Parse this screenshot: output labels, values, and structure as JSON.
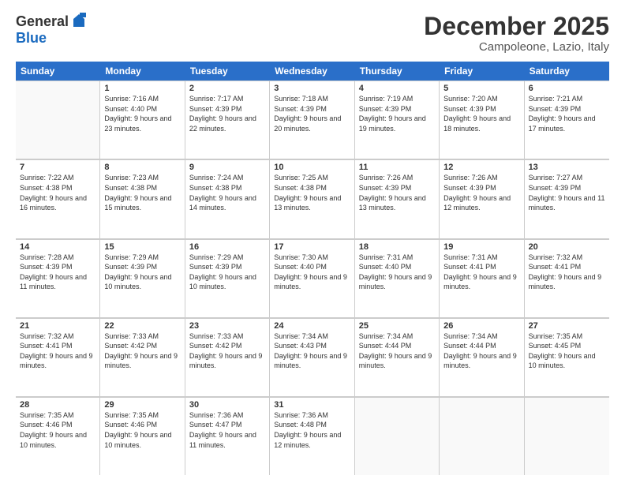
{
  "logo": {
    "general": "General",
    "blue": "Blue"
  },
  "title": "December 2025",
  "location": "Campoleone, Lazio, Italy",
  "header_days": [
    "Sunday",
    "Monday",
    "Tuesday",
    "Wednesday",
    "Thursday",
    "Friday",
    "Saturday"
  ],
  "rows": [
    [
      {
        "day": "",
        "sunrise": "",
        "sunset": "",
        "daylight": "",
        "empty": true
      },
      {
        "day": "1",
        "sunrise": "Sunrise: 7:16 AM",
        "sunset": "Sunset: 4:40 PM",
        "daylight": "Daylight: 9 hours and 23 minutes."
      },
      {
        "day": "2",
        "sunrise": "Sunrise: 7:17 AM",
        "sunset": "Sunset: 4:39 PM",
        "daylight": "Daylight: 9 hours and 22 minutes."
      },
      {
        "day": "3",
        "sunrise": "Sunrise: 7:18 AM",
        "sunset": "Sunset: 4:39 PM",
        "daylight": "Daylight: 9 hours and 20 minutes."
      },
      {
        "day": "4",
        "sunrise": "Sunrise: 7:19 AM",
        "sunset": "Sunset: 4:39 PM",
        "daylight": "Daylight: 9 hours and 19 minutes."
      },
      {
        "day": "5",
        "sunrise": "Sunrise: 7:20 AM",
        "sunset": "Sunset: 4:39 PM",
        "daylight": "Daylight: 9 hours and 18 minutes."
      },
      {
        "day": "6",
        "sunrise": "Sunrise: 7:21 AM",
        "sunset": "Sunset: 4:39 PM",
        "daylight": "Daylight: 9 hours and 17 minutes."
      }
    ],
    [
      {
        "day": "7",
        "sunrise": "Sunrise: 7:22 AM",
        "sunset": "Sunset: 4:38 PM",
        "daylight": "Daylight: 9 hours and 16 minutes."
      },
      {
        "day": "8",
        "sunrise": "Sunrise: 7:23 AM",
        "sunset": "Sunset: 4:38 PM",
        "daylight": "Daylight: 9 hours and 15 minutes."
      },
      {
        "day": "9",
        "sunrise": "Sunrise: 7:24 AM",
        "sunset": "Sunset: 4:38 PM",
        "daylight": "Daylight: 9 hours and 14 minutes."
      },
      {
        "day": "10",
        "sunrise": "Sunrise: 7:25 AM",
        "sunset": "Sunset: 4:38 PM",
        "daylight": "Daylight: 9 hours and 13 minutes."
      },
      {
        "day": "11",
        "sunrise": "Sunrise: 7:26 AM",
        "sunset": "Sunset: 4:39 PM",
        "daylight": "Daylight: 9 hours and 13 minutes."
      },
      {
        "day": "12",
        "sunrise": "Sunrise: 7:26 AM",
        "sunset": "Sunset: 4:39 PM",
        "daylight": "Daylight: 9 hours and 12 minutes."
      },
      {
        "day": "13",
        "sunrise": "Sunrise: 7:27 AM",
        "sunset": "Sunset: 4:39 PM",
        "daylight": "Daylight: 9 hours and 11 minutes."
      }
    ],
    [
      {
        "day": "14",
        "sunrise": "Sunrise: 7:28 AM",
        "sunset": "Sunset: 4:39 PM",
        "daylight": "Daylight: 9 hours and 11 minutes."
      },
      {
        "day": "15",
        "sunrise": "Sunrise: 7:29 AM",
        "sunset": "Sunset: 4:39 PM",
        "daylight": "Daylight: 9 hours and 10 minutes."
      },
      {
        "day": "16",
        "sunrise": "Sunrise: 7:29 AM",
        "sunset": "Sunset: 4:39 PM",
        "daylight": "Daylight: 9 hours and 10 minutes."
      },
      {
        "day": "17",
        "sunrise": "Sunrise: 7:30 AM",
        "sunset": "Sunset: 4:40 PM",
        "daylight": "Daylight: 9 hours and 9 minutes."
      },
      {
        "day": "18",
        "sunrise": "Sunrise: 7:31 AM",
        "sunset": "Sunset: 4:40 PM",
        "daylight": "Daylight: 9 hours and 9 minutes."
      },
      {
        "day": "19",
        "sunrise": "Sunrise: 7:31 AM",
        "sunset": "Sunset: 4:41 PM",
        "daylight": "Daylight: 9 hours and 9 minutes."
      },
      {
        "day": "20",
        "sunrise": "Sunrise: 7:32 AM",
        "sunset": "Sunset: 4:41 PM",
        "daylight": "Daylight: 9 hours and 9 minutes."
      }
    ],
    [
      {
        "day": "21",
        "sunrise": "Sunrise: 7:32 AM",
        "sunset": "Sunset: 4:41 PM",
        "daylight": "Daylight: 9 hours and 9 minutes."
      },
      {
        "day": "22",
        "sunrise": "Sunrise: 7:33 AM",
        "sunset": "Sunset: 4:42 PM",
        "daylight": "Daylight: 9 hours and 9 minutes."
      },
      {
        "day": "23",
        "sunrise": "Sunrise: 7:33 AM",
        "sunset": "Sunset: 4:42 PM",
        "daylight": "Daylight: 9 hours and 9 minutes."
      },
      {
        "day": "24",
        "sunrise": "Sunrise: 7:34 AM",
        "sunset": "Sunset: 4:43 PM",
        "daylight": "Daylight: 9 hours and 9 minutes."
      },
      {
        "day": "25",
        "sunrise": "Sunrise: 7:34 AM",
        "sunset": "Sunset: 4:44 PM",
        "daylight": "Daylight: 9 hours and 9 minutes."
      },
      {
        "day": "26",
        "sunrise": "Sunrise: 7:34 AM",
        "sunset": "Sunset: 4:44 PM",
        "daylight": "Daylight: 9 hours and 9 minutes."
      },
      {
        "day": "27",
        "sunrise": "Sunrise: 7:35 AM",
        "sunset": "Sunset: 4:45 PM",
        "daylight": "Daylight: 9 hours and 10 minutes."
      }
    ],
    [
      {
        "day": "28",
        "sunrise": "Sunrise: 7:35 AM",
        "sunset": "Sunset: 4:46 PM",
        "daylight": "Daylight: 9 hours and 10 minutes."
      },
      {
        "day": "29",
        "sunrise": "Sunrise: 7:35 AM",
        "sunset": "Sunset: 4:46 PM",
        "daylight": "Daylight: 9 hours and 10 minutes."
      },
      {
        "day": "30",
        "sunrise": "Sunrise: 7:36 AM",
        "sunset": "Sunset: 4:47 PM",
        "daylight": "Daylight: 9 hours and 11 minutes."
      },
      {
        "day": "31",
        "sunrise": "Sunrise: 7:36 AM",
        "sunset": "Sunset: 4:48 PM",
        "daylight": "Daylight: 9 hours and 12 minutes."
      },
      {
        "day": "",
        "sunrise": "",
        "sunset": "",
        "daylight": "",
        "empty": true
      },
      {
        "day": "",
        "sunrise": "",
        "sunset": "",
        "daylight": "",
        "empty": true
      },
      {
        "day": "",
        "sunrise": "",
        "sunset": "",
        "daylight": "",
        "empty": true
      }
    ]
  ]
}
